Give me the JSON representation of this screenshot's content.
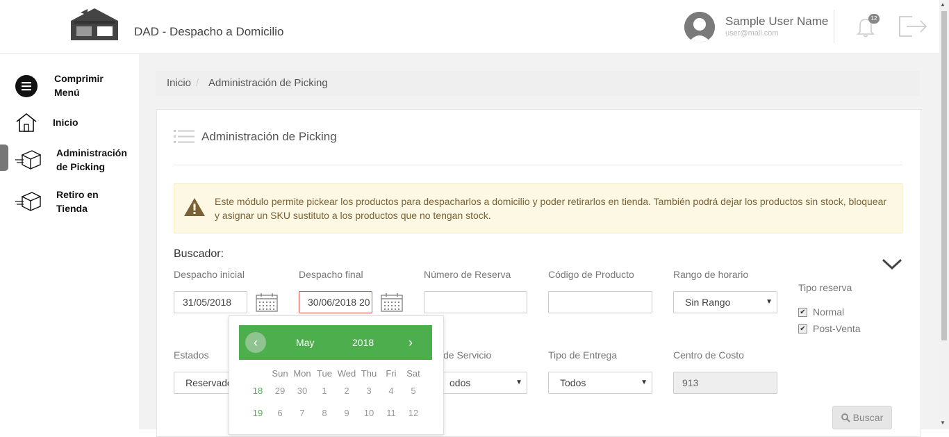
{
  "header": {
    "app_title": "DAD - Despacho a Domicilio",
    "user_name": "Sample User Name",
    "user_email": "user@mail.com",
    "notification_count": "12"
  },
  "sidebar": {
    "items": [
      {
        "line1": "Comprimir",
        "line2": "Menú"
      },
      {
        "line1": "Inicio",
        "line2": ""
      },
      {
        "line1": "Administración",
        "line2": "de Picking"
      },
      {
        "line1": "Retiro en",
        "line2": "Tienda"
      }
    ]
  },
  "breadcrumb": {
    "home": "Inicio",
    "separator": "/",
    "current": "Administración de Picking"
  },
  "panel": {
    "title": "Administración de Picking",
    "alert": "Este módulo permite pickear los productos para despacharlos a domicilio y poder retirarlos en tienda. También podrá dejar los productos sin stock, bloquear y asignar un SKU sustituto a los productos que no tengan stock."
  },
  "search": {
    "title": "Buscador:",
    "despacho_inicial": {
      "label": "Despacho inicial",
      "value": "31/05/2018"
    },
    "despacho_final": {
      "label": "Despacho final",
      "value": "30/06/2018 20"
    },
    "numero_reserva": {
      "label": "Número de Reserva",
      "value": ""
    },
    "codigo_producto": {
      "label": "Código de Producto",
      "value": ""
    },
    "rango_horario": {
      "label": "Rango de horario",
      "value": "Sin Rango"
    },
    "tipo_reserva": {
      "label": "Tipo reserva",
      "opt1": "Normal",
      "opt2": "Post-Venta",
      "opt1_checked": true,
      "opt2_checked": true
    },
    "estados": {
      "label": "Estados",
      "value": "Reservado"
    },
    "tipo_servicio": {
      "label": "de Servicio",
      "value": "odos"
    },
    "tipo_entrega": {
      "label": "Tipo de Entrega",
      "value": "Todos"
    },
    "centro_costo": {
      "label": "Centro de Costo",
      "value": "913"
    },
    "buscar_label": "Buscar"
  },
  "datepicker": {
    "prev": "‹",
    "next": "›",
    "month": "May",
    "year": "2018",
    "dow": [
      "Sun",
      "Mon",
      "Tue",
      "Wed",
      "Thu",
      "Fri",
      "Sat"
    ],
    "weeks": [
      {
        "num": "18",
        "days": [
          "29",
          "30",
          "1",
          "2",
          "3",
          "4",
          "5"
        ]
      },
      {
        "num": "19",
        "days": [
          "6",
          "7",
          "8",
          "9",
          "10",
          "11",
          "12"
        ]
      }
    ]
  }
}
